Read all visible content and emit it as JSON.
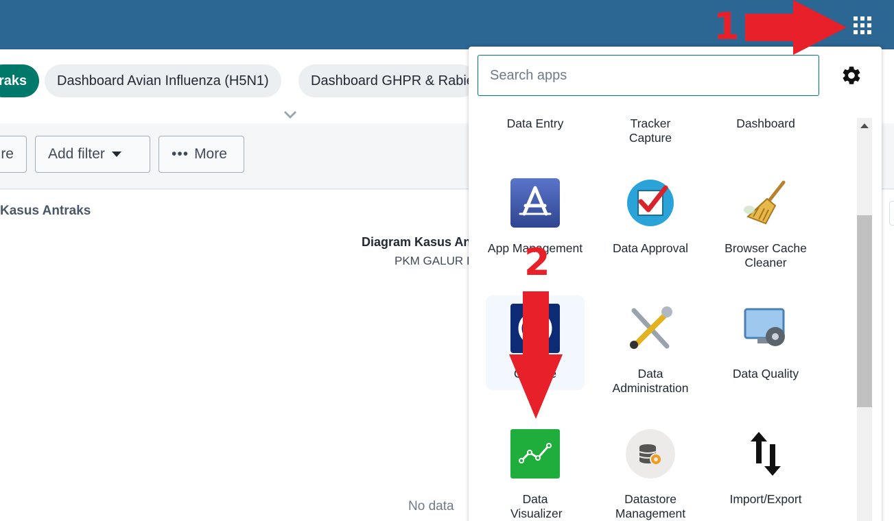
{
  "header": {
    "apps_icon": "apps-grid-icon"
  },
  "dashboard_chips": [
    {
      "label": "raks",
      "active": true
    },
    {
      "label": "Dashboard Avian Influenza (H5N1)",
      "active": false
    },
    {
      "label": "Dashboard GHPR & Rabie",
      "active": false
    }
  ],
  "controls": {
    "share_label": "re",
    "add_filter_label": "Add filter",
    "more_label": "More"
  },
  "content": {
    "item_title": "Kasus Antraks",
    "chart_title": "Diagram Kasus An",
    "chart_subtitle": "PKM GALUR I",
    "no_data": "No data"
  },
  "app_menu": {
    "search_placeholder": "Search apps",
    "settings_icon": "gear-icon",
    "apps": [
      {
        "label": "Data Entry",
        "icon": "none"
      },
      {
        "label": "Tracker Capture",
        "icon": "none"
      },
      {
        "label": "Dashboard",
        "icon": "none"
      },
      {
        "label": "App Management",
        "icon": "app-management-icon"
      },
      {
        "label": "Data Approval",
        "icon": "data-approval-icon"
      },
      {
        "label": "Browser Cache Cleaner",
        "icon": "broom-icon"
      },
      {
        "label": "Capture",
        "icon": "capture-icon"
      },
      {
        "label": "Data Administration",
        "icon": "tools-icon"
      },
      {
        "label": "Data Quality",
        "icon": "data-quality-icon"
      },
      {
        "label": "Data Visualizer",
        "icon": "line-chart-icon"
      },
      {
        "label": "Datastore Management",
        "icon": "datastore-icon"
      },
      {
        "label": "Import/Export",
        "icon": "import-export-arrows-icon"
      }
    ]
  },
  "annotations": [
    {
      "number": "1",
      "color": "#e8202a"
    },
    {
      "number": "2",
      "color": "#e8202a"
    }
  ]
}
